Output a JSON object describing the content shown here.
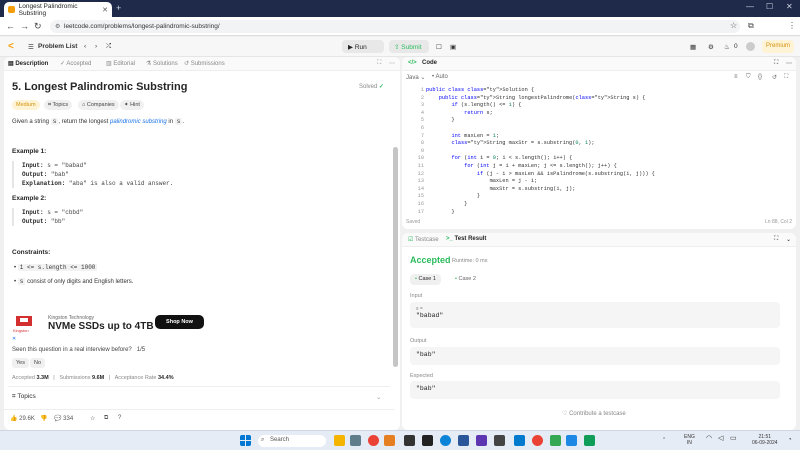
{
  "browser": {
    "tab_title": "Longest Palindromic Substring",
    "url": "leetcode.com/problems/longest-palindromic-substring/"
  },
  "header": {
    "problem_list": "Problem List",
    "run": "Run",
    "submit": "Submit",
    "notifications_count": "0",
    "premium": "Premium"
  },
  "left_tabs": [
    "Description",
    "Accepted",
    "Editorial",
    "Solutions",
    "Submissions"
  ],
  "problem": {
    "title": "5. Longest Palindromic Substring",
    "solved": "Solved",
    "difficulty": "Medium",
    "chips": [
      "Topics",
      "Companies",
      "Hint"
    ],
    "desc_pre": "Given a string",
    "desc_s": "s",
    "desc_mid": ", return the longest",
    "desc_link": "palindromic substring",
    "desc_post": "in",
    "desc_s2": "s",
    "desc_end": ".",
    "examples": [
      {
        "label": "Example 1:",
        "input_label": "Input:",
        "input": "s = \"babad\"",
        "output_label": "Output:",
        "output": "\"bab\"",
        "expl_label": "Explanation:",
        "expl": "\"aba\" is also a valid answer."
      },
      {
        "label": "Example 2:",
        "input_label": "Input:",
        "input": "s = \"cbbd\"",
        "output_label": "Output:",
        "output": "\"bb\""
      }
    ],
    "constraints_label": "Constraints:",
    "constraint1": "1 <= s.length <= 1000",
    "constraint2_code": "s",
    "constraint2_text": "consist of only digits and English letters."
  },
  "ad": {
    "brand": "Kingston",
    "by": "Kingston Technology",
    "headline": "NVMe SSDs up to 4TB",
    "cta": "Shop Now"
  },
  "interview": {
    "question": "Seen this question in a real interview before?",
    "count": "1/5",
    "yes": "Yes",
    "no": "No"
  },
  "stats": {
    "accepted_label": "Accepted",
    "accepted": "3.3M",
    "submissions_label": "Submissions",
    "submissions": "9.6M",
    "rate_label": "Acceptance Rate",
    "rate": "34.4%"
  },
  "topics_label": "Topics",
  "footer": {
    "likes": "29.6K",
    "comments": "334"
  },
  "code_panel": {
    "title": "Code",
    "language": "Java",
    "mode": "Auto",
    "saved": "Saved",
    "cursor": "Ln 88, Col 2",
    "line_numbers": [
      "1",
      "2",
      "3",
      "4",
      "5",
      "6",
      "7",
      "8",
      "9",
      "10",
      "11",
      "12",
      "13",
      "14",
      "15",
      "16",
      "17"
    ],
    "lines": [
      "public class Solution {",
      "    public String longestPalindrome(String s) {",
      "        if (s.length() <= 1) {",
      "            return s;",
      "        }",
      "",
      "        int maxLen = 1;",
      "        String maxStr = s.substring(0, 1);",
      "",
      "        for (int i = 0; i < s.length(); i++) {",
      "            for (int j = i + maxLen; j <= s.length(); j++) {",
      "                if (j - i > maxLen && isPalindrome(s.substring(i, j))) {",
      "                    maxLen = j - i;",
      "                    maxStr = s.substring(i, j);",
      "                }",
      "            }",
      "        }"
    ]
  },
  "result_panel": {
    "tab_testcase": "Testcase",
    "tab_result": "Test Result",
    "status": "Accepted",
    "runtime": "Runtime: 0 ms",
    "case1": "Case 1",
    "case2": "Case 2",
    "input_label": "Input",
    "input_var": "s =",
    "input_value": "\"babad\"",
    "output_label": "Output",
    "output_value": "\"bab\"",
    "expected_label": "Expected",
    "expected_value": "\"bab\"",
    "contribute": "Contribute a testcase"
  },
  "taskbar": {
    "search": "Search",
    "lang": "ENG",
    "region": "IN",
    "time": "21:51",
    "date": "06-09-2024"
  },
  "colors": {
    "accent_green": "#2cbb5d",
    "medium_orange": "#d4920b",
    "browser_frame": "#1f2a4a"
  }
}
